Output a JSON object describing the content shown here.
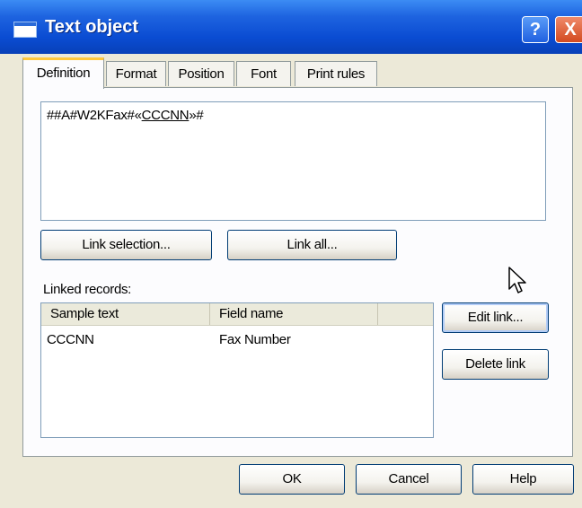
{
  "window": {
    "title": "Text object",
    "help_button": "?",
    "close_button": "X"
  },
  "tabs": [
    {
      "label": "Definition",
      "active": true
    },
    {
      "label": "Format",
      "active": false
    },
    {
      "label": "Position",
      "active": false
    },
    {
      "label": "Font",
      "active": false
    },
    {
      "label": "Print rules",
      "active": false
    }
  ],
  "editor": {
    "prefix": "##A#W2KFax#«",
    "link_text": "CCCNN",
    "suffix": "»#"
  },
  "buttons": {
    "link_selection": "Link selection...",
    "link_all": "Link all...",
    "edit_link": "Edit link...",
    "delete_link": "Delete link",
    "ok": "OK",
    "cancel": "Cancel",
    "help": "Help"
  },
  "linked_records": {
    "label": "Linked records:",
    "columns": [
      "Sample text",
      "Field name"
    ],
    "rows": [
      {
        "sample_text": "CCCNN",
        "field_name": "Fax Number"
      }
    ]
  },
  "icons": {
    "window_icon": "window-icon",
    "cursor": "mouse-pointer-icon"
  },
  "colors": {
    "titlebar": "#0A4CD2",
    "dialog_face": "#ECE9D8",
    "active_tab_accent": "#FFC83C",
    "close_button": "#D24A20"
  }
}
